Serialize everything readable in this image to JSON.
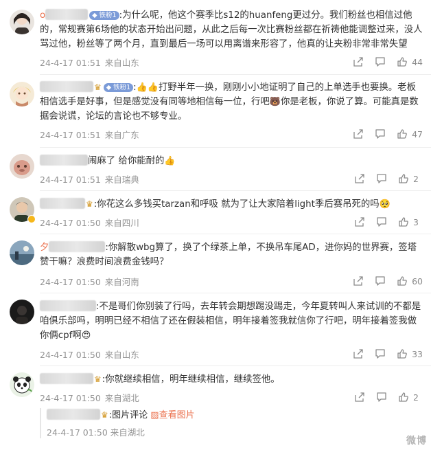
{
  "comments": [
    {
      "name_prefix": "o",
      "fan_badge": "铁粉1",
      "text": ":为什么呢，他这个赛季比s12的huanfeng更过分。我们粉丝也相信过他的，常规赛第6场他的状态开始出问题，从此之后每一次比赛粉丝都在祈祷他能调整过来，没人骂过他，粉丝等了两个月，直到最后一场可以用离谱来形容了，他真的让夹粉非常非常失望",
      "time": "24-4-17 01:51",
      "location": "来自山东",
      "likes": "44"
    },
    {
      "fan_badge": "铁粉1",
      "text": "打野半年一换，刚刚小小地证明了自己的上单选手也要换。老板相信选手是好事，但是感觉没有同等地相信每一位，行吧",
      "text2": "你是老板，你说了算。可能真是数据会说谎，论坛的言论也不够专业。",
      "time": "24-4-17 01:51",
      "location": "来自广东",
      "likes": "47"
    },
    {
      "text": "闹麻了 给你能耐的",
      "time": "24-4-17 01:51",
      "location": "来自瑞典",
      "likes": "2"
    },
    {
      "text": ":你花这么多钱买tarzan和呼吸 就为了让大家陪着light季后赛吊死的吗",
      "time": "24-4-17 01:50",
      "location": "来自四川",
      "likes": "3"
    },
    {
      "text": ":你解散wbg算了，换了个绿茶上单，不换吊车尾AD，进你妈的世界赛，签塔赞干嘛？浪费时间浪费金钱吗？",
      "time": "24-4-17 01:50",
      "location": "来自河南",
      "likes": "60"
    },
    {
      "text": ":不是哥们你别装了行吗，去年转会期想踢没踢走，今年夏转叫人来试训的不都是咱俱乐部吗，明明已经不相信了还在假装相信，明年接着签我就信你了行吧，明年接着签我做你俩cpf啊",
      "time": "24-4-17 01:50",
      "location": "来自山东",
      "likes": "33"
    },
    {
      "text": ":你就继续相信，明年继续相信，继续签他。",
      "time": "24-4-17 01:50",
      "location": "来自湖北",
      "likes": "2"
    }
  ],
  "reply": {
    "text": ":图片评论",
    "link": "查看图片",
    "time": "24-4-17 01:50",
    "location": "来自湖北"
  },
  "watermark": "微博",
  "icons": {
    "share": "share-icon",
    "comment": "comment-icon",
    "like": "thumbs-up-icon"
  },
  "colors": {
    "meta_gray": "#939393",
    "link_orange": "#eb7350",
    "fan_badge_blue": "#7b9bd8"
  }
}
